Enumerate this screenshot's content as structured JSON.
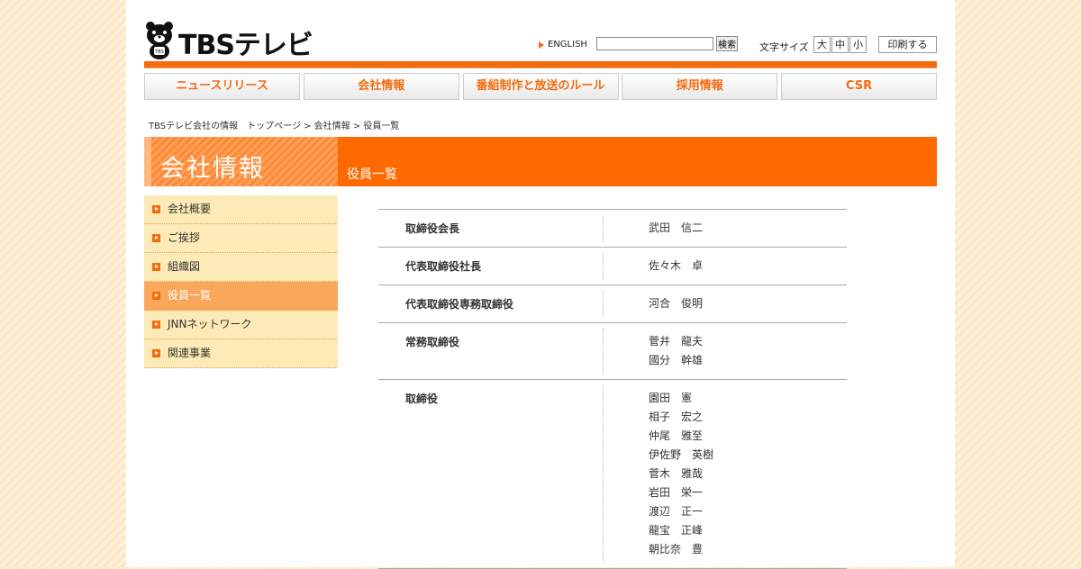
{
  "header": {
    "logo_text": "TBSテレビ",
    "english_link": "ENGLISH",
    "search_button": "検索",
    "search_placeholder": "",
    "font_size_label": "文字サイズ",
    "font_sizes": [
      "大",
      "中",
      "小"
    ],
    "print_button": "印刷する",
    "accent_color": "#f36c10"
  },
  "nav": {
    "items": [
      "ニュースリリース",
      "会社情報",
      "番組制作と放送のルール",
      "採用情報",
      "CSR"
    ]
  },
  "breadcrumb": {
    "site": "TBSテレビ会社の情報",
    "path": "トップページ > 会社情報 > 役員一覧"
  },
  "banner": {
    "title": "会社情報",
    "subtitle": "役員一覧"
  },
  "sidebar": {
    "items": [
      "会社概要",
      "ご挨拶",
      "組織図",
      "役員一覧",
      "JNNネットワーク",
      "関連事業"
    ],
    "active_index": 3
  },
  "executives": [
    {
      "title": "取締役会長",
      "names": [
        "武田　信二"
      ]
    },
    {
      "title": "代表取締役社長",
      "names": [
        "佐々木　卓"
      ]
    },
    {
      "title": "代表取締役専務取締役",
      "names": [
        "河合　俊明"
      ]
    },
    {
      "title": "常務取締役",
      "names": [
        "菅井　龍夫",
        "國分　幹雄"
      ]
    },
    {
      "title": "取締役",
      "names": [
        "園田　憲",
        "相子　宏之",
        "仲尾　雅至",
        "伊佐野　英樹",
        "菅木　雅哉",
        "岩田　栄一",
        "渡辺　正一",
        "龍宝　正峰",
        "朝比奈　豊"
      ]
    }
  ]
}
